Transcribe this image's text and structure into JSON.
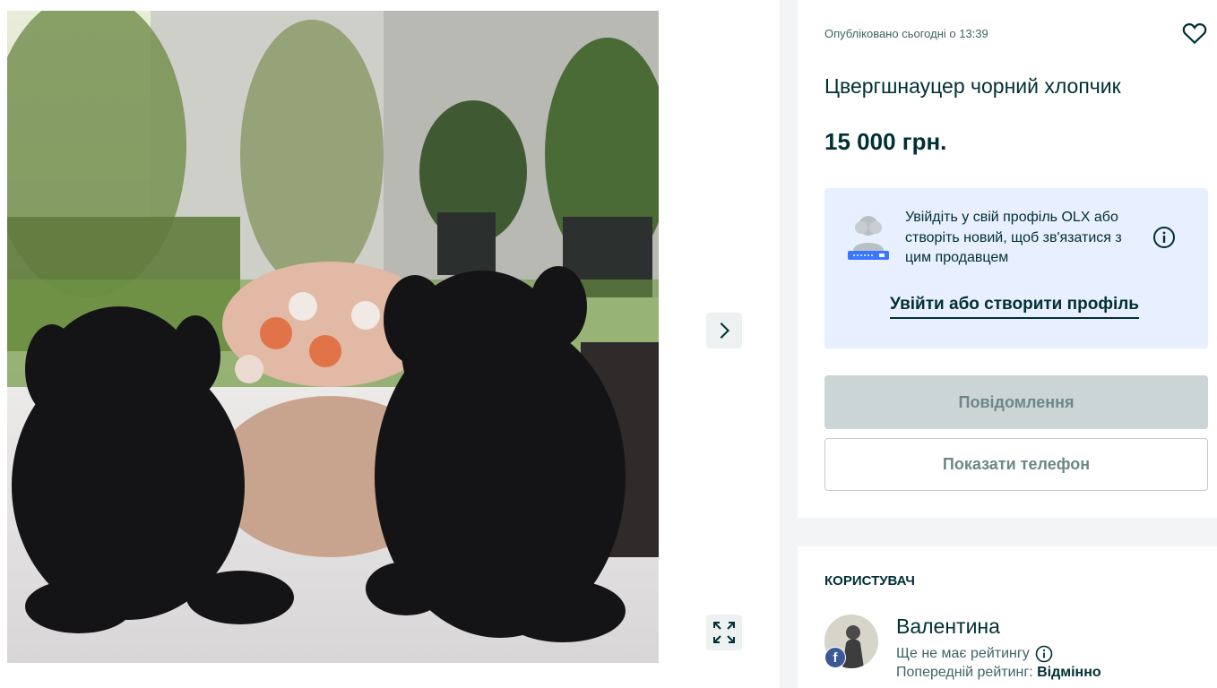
{
  "listing": {
    "posted": "Опубліковано сьогодні о 13:39",
    "title": "Цвергшнауцер чорний хлопчик",
    "price": "15 000 грн."
  },
  "login_prompt": {
    "text": "Увійдіть у свій профіль OLX або створіть новий, щоб зв'язатися з цим продавцем",
    "link": "Увійти або створити профіль"
  },
  "buttons": {
    "message": "Повідомлення",
    "phone": "Показати телефон"
  },
  "user": {
    "heading": "КОРИСТУВАЧ",
    "name": "Валентина",
    "rating": "Ще не має рейтингу",
    "prev_label": "Попередній рейтинг:",
    "prev_value": "Відмінно"
  },
  "icons": {
    "favorite": "heart-icon",
    "next": "chevron-right-icon",
    "fullscreen": "expand-icon",
    "info": "info-icon",
    "facebook": "facebook-icon"
  },
  "colors": {
    "text": "#002f34",
    "login_box_bg": "#e8effe",
    "message_btn_bg": "#cbd5d6",
    "facebook": "#3b5998"
  }
}
